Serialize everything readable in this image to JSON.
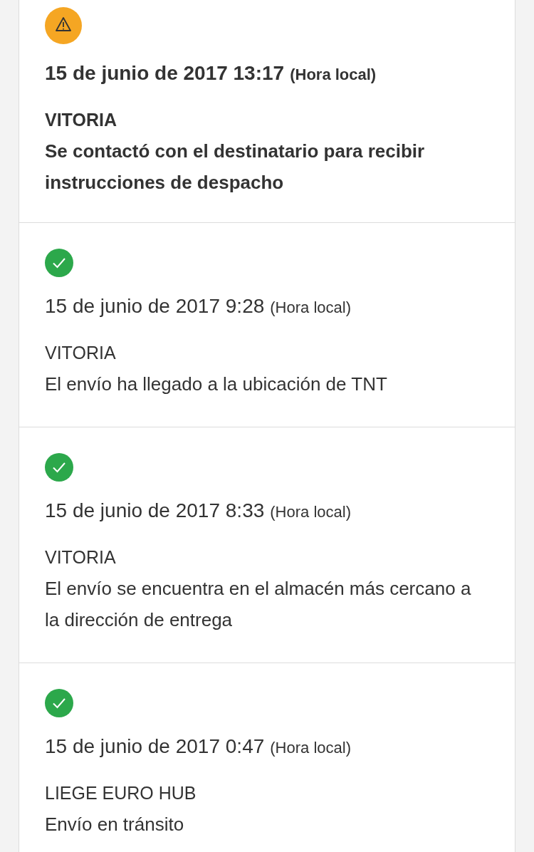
{
  "events": [
    {
      "kind": "warning",
      "date": "15 de junio de 2017 13:17",
      "zone": "(Hora local)",
      "location": "VITORIA",
      "description": "Se contactó con el destinatario para recibir instrucciones de despacho"
    },
    {
      "kind": "done",
      "date": "15 de junio de 2017 9:28",
      "zone": "(Hora local)",
      "location": "VITORIA",
      "description": "El envío ha llegado a la ubicación de TNT"
    },
    {
      "kind": "done",
      "date": "15 de junio de 2017 8:33",
      "zone": "(Hora local)",
      "location": "VITORIA",
      "description": "El envío se encuentra en el almacén más cercano a la dirección de entrega"
    },
    {
      "kind": "done",
      "date": "15 de junio de 2017 0:47",
      "zone": "(Hora local)",
      "location": "LIEGE EURO HUB",
      "description": "Envío en tránsito"
    }
  ]
}
